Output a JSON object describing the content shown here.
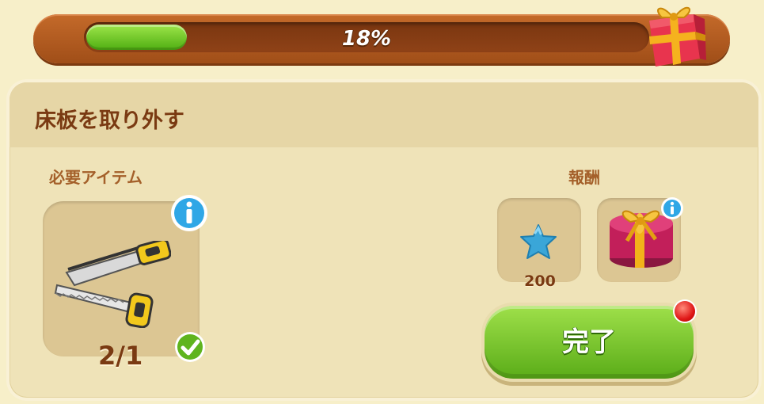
{
  "progress": {
    "percent_text": "18%",
    "fraction": 0.18
  },
  "quest": {
    "title": "床板を取り外す",
    "required_label": "必要アイテム",
    "reward_label": "報酬",
    "item": {
      "icon": "saw-icon",
      "count_text": "2/1",
      "complete": true
    },
    "rewards": [
      {
        "icon": "blue-star-icon",
        "amount": "200"
      },
      {
        "icon": "gift-box-icon",
        "amount": ""
      }
    ],
    "complete_button": "完了"
  },
  "colors": {
    "accent_green": "#5aac18",
    "bar_orange": "#c46a2a",
    "title_brown": "#7a3a12",
    "label_brown": "#a4602a",
    "panel_bg": "#efe3b8"
  }
}
